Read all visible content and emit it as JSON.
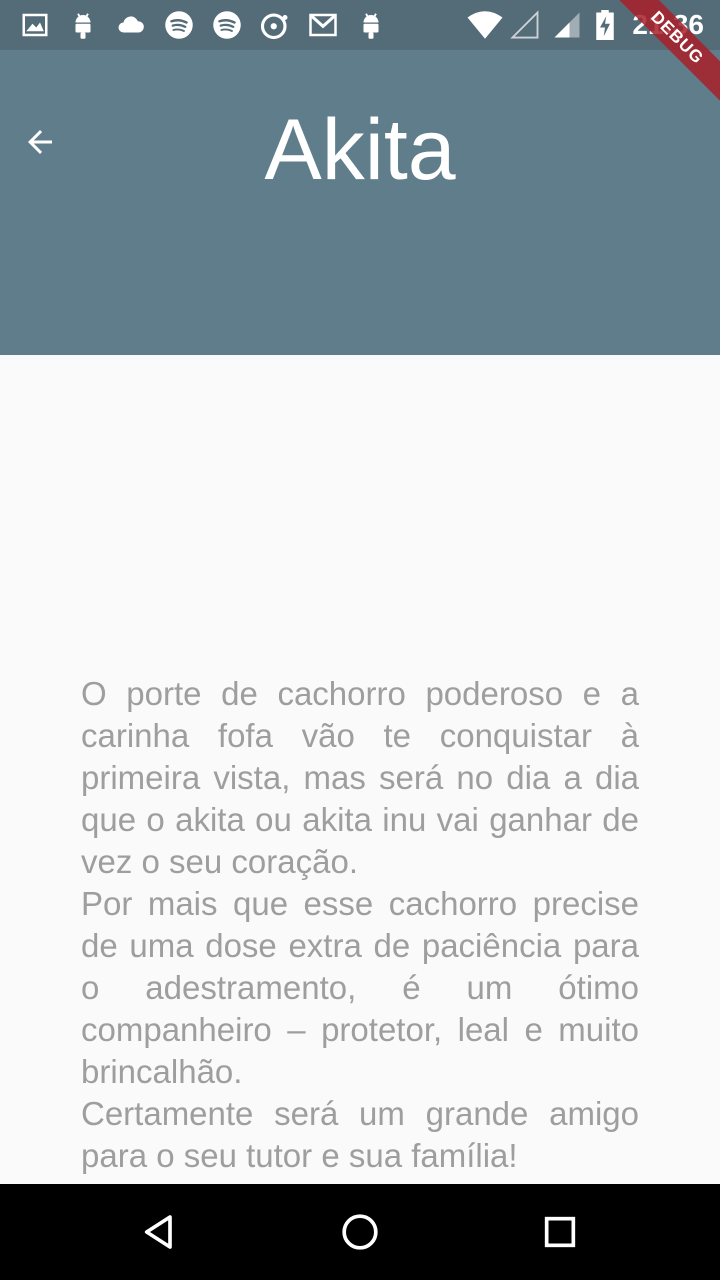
{
  "status_bar": {
    "time": "21:36",
    "icons": [
      "image-icon",
      "android-icon",
      "cloud-icon",
      "spotify-icon",
      "spotify-icon",
      "music-disc-icon",
      "gmail-icon",
      "android-icon",
      "wifi-icon",
      "signal-empty-icon",
      "signal-icon",
      "battery-charging-icon"
    ]
  },
  "app_bar": {
    "title": "Akita",
    "back_icon": "arrow-back-icon"
  },
  "debug_banner": "DEBUG",
  "content": {
    "paragraphs": [
      "O porte de cachorro poderoso e a carinha fofa vão te conquistar à primeira vista, mas será no dia a dia que o akita ou akita inu vai ganhar de vez o seu coração.",
      "Por mais que esse cachorro precise de uma dose extra de paciência para o adestramento, é um ótimo companheiro – protetor, leal e muito brincalhão.",
      "Certamente será um grande amigo para o seu tutor e sua família!"
    ]
  },
  "nav_bar": {
    "back": "nav-back-icon",
    "home": "nav-home-icon",
    "recents": "nav-recents-icon"
  },
  "colors": {
    "app_bar": "#607d8b",
    "status_bar": "#546b78",
    "body_text": "#9e9e9e",
    "background": "#fafafa"
  }
}
